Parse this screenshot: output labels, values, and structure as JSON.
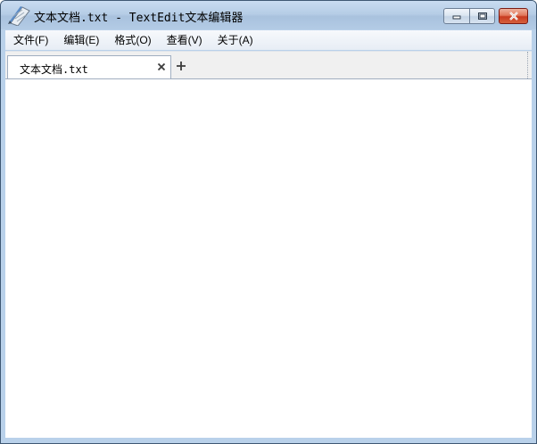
{
  "window": {
    "title": "文本文档.txt - TextEdit文本编辑器"
  },
  "menu": [
    {
      "label": "文件(F)"
    },
    {
      "label": "编辑(E)"
    },
    {
      "label": "格式(O)"
    },
    {
      "label": "查看(V)"
    },
    {
      "label": "关于(A)"
    }
  ],
  "tabs": [
    {
      "label": "文本文档.txt",
      "active": true
    }
  ],
  "icons": {
    "app": "notepad-icon",
    "minimize": "minimize-icon",
    "maximize": "maximize-icon",
    "close": "close-icon",
    "tab_close": "close-tab-icon",
    "tab_add": "plus-icon"
  },
  "editor": {
    "content": ""
  },
  "colors": {
    "frame": "#b9d1ea",
    "close_button": "#c83a20",
    "editor_bg": "#ffffff"
  }
}
